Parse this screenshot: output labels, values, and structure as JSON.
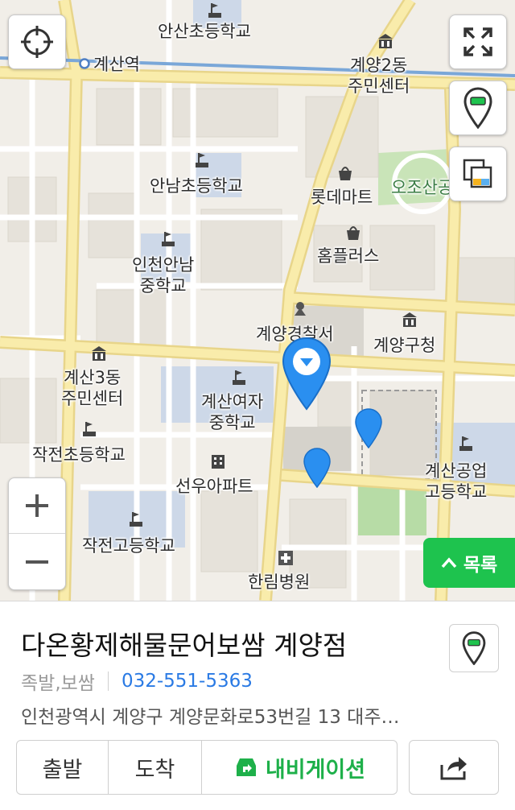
{
  "map": {
    "labels": {
      "ansan_school": "안산초등학교",
      "gyesan_station": "계산역",
      "gyeyang2": "계양2동\n주민센터",
      "lotte_mart": "롯데마트",
      "ojo_mountain": "오조산공",
      "annam_school": "안남초등학교",
      "homeplus": "홈플러스",
      "incheon_annam": "인천안남\n중학교",
      "police": "계양경찰서",
      "gyeyang_office": "계양구청",
      "gyesan3": "계산3동\n주민센터",
      "girls_school": "계산여자\n중학교",
      "jakjeon_elem": "작전초등학교",
      "seonwoo_apt": "선우아파트",
      "technical_school": "계산공업\n고등학교",
      "jakjeon_high": "작전고등학교",
      "hallym": "한림병원"
    },
    "controls": {
      "location_icon": "crosshair-icon",
      "fullscreen_icon": "expand-icon",
      "pin_icon": "map-pin-icon",
      "layers_icon": "layers-icon",
      "zoom_in": "+",
      "zoom_out": "−"
    },
    "list_button": "목록",
    "colors": {
      "pin": "#2a8ff0",
      "accent_green": "#1ec34e",
      "road": "#f7e9a0",
      "park": "#c9e4b8"
    }
  },
  "place": {
    "name": "다온황제해물문어보쌈 계양점",
    "category": "족발,보쌈",
    "phone": "032-551-5363",
    "address": "인천광역시 계양구 계양문화로53번길 13 대주…"
  },
  "actions": {
    "depart": "출발",
    "arrive": "도착",
    "navigation": "내비게이션"
  }
}
